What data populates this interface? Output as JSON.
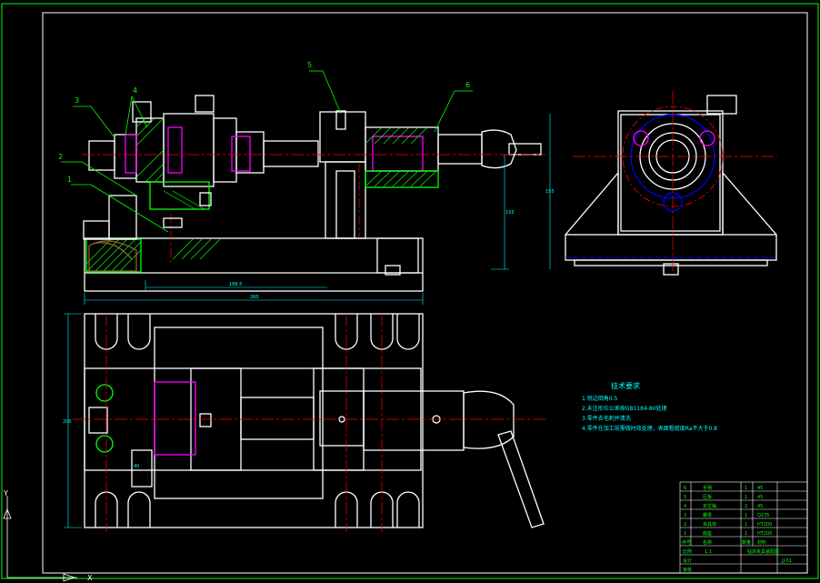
{
  "colors": {
    "background": "#000000",
    "outline": "#ffffff",
    "border": "#00ff00",
    "center_line": "#ff0000",
    "section_hatch": "#00ff00",
    "dimension": "#00ffff",
    "hidden": "#0000ff",
    "highlight": "#ff00ff",
    "leader": "#00ff00",
    "part_brown": "#996633",
    "note_text": "#00ffff",
    "title_text": "#00ff00"
  },
  "balloons": {
    "p1": "1",
    "p2": "2",
    "p3": "3",
    "p4": "4",
    "p5": "5",
    "p6": "6"
  },
  "tech_requirements": {
    "title": "技术要求",
    "lines": [
      "1.锐边倒角0.5",
      "2.未注形位公差按GB1184-80处理",
      "3.零件去毛刺并清洗",
      "4.零件在加工前需做时效处理，表面粗糙度Ra不大于0.8"
    ]
  },
  "dimensions": {
    "overall_length": "260",
    "sub_length": "188.5",
    "height_front": "155",
    "height_side": "155",
    "plan_width": "200",
    "plan_small": "40"
  },
  "title_block": {
    "parts": [
      {
        "no": "6",
        "name": "手柄",
        "qty": "1",
        "material": "45"
      },
      {
        "no": "5",
        "name": "压板",
        "qty": "1",
        "material": "45"
      },
      {
        "no": "4",
        "name": "定位销",
        "qty": "2",
        "material": "45"
      },
      {
        "no": "3",
        "name": "螺母",
        "qty": "1",
        "material": "Q235"
      },
      {
        "no": "2",
        "name": "夹具体",
        "qty": "1",
        "material": "HT200"
      },
      {
        "no": "1",
        "name": "底座",
        "qty": "1",
        "material": "HT200"
      }
    ],
    "header": {
      "no": "序号",
      "name": "名称",
      "qty": "数量",
      "material": "材料"
    },
    "drawing_name": "钻床夹具装配图",
    "scale_label": "比例",
    "scale": "1:1",
    "designer": "设计",
    "checker": "审核",
    "drawing_no": "JJ-01"
  },
  "ucs": {
    "y": "Y",
    "x": "X"
  }
}
